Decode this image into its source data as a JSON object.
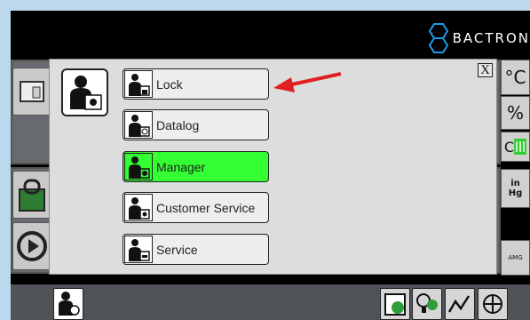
{
  "brand": {
    "name": "BACTRON"
  },
  "right_panel": {
    "celsius": "°C",
    "percent": "%",
    "letter": "C",
    "pressure": "in\nHg",
    "amg": "AMG"
  },
  "menu": {
    "items": [
      {
        "label": "Lock",
        "icon": "lock-icon",
        "active": false
      },
      {
        "label": "Datalog",
        "icon": "datalog-icon",
        "active": false
      },
      {
        "label": "Manager",
        "icon": "manager-icon",
        "active": true
      },
      {
        "label": "Customer Service",
        "icon": "customer-service-icon",
        "active": false
      },
      {
        "label": "Service",
        "icon": "service-icon",
        "active": false
      }
    ],
    "close_label": "X"
  },
  "colors": {
    "active": "#33ff33",
    "arrow": "#e02020",
    "modal_bg": "#dcdedd"
  },
  "bottom_icons": [
    "user-status-icon",
    "calendar-icon",
    "lightbulb-icon",
    "graph-icon",
    "network-icon"
  ]
}
